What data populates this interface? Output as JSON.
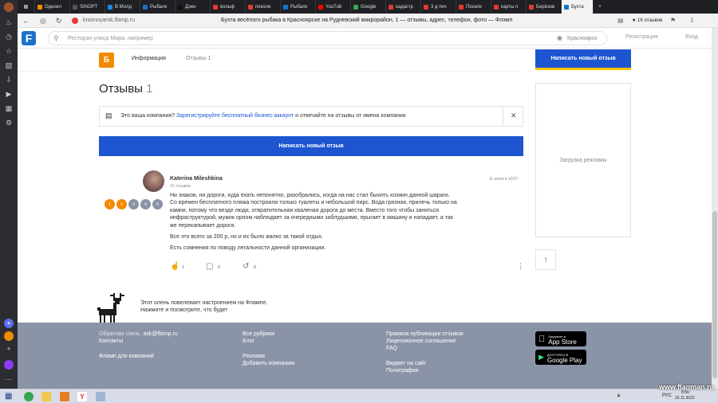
{
  "browser": {
    "tabs": [
      {
        "label": "Однокл",
        "color": "#f28a00"
      },
      {
        "label": "SINOPT",
        "color": "#555555"
      },
      {
        "label": "В Молд",
        "color": "#1e88e5"
      },
      {
        "label": "Рыбалк",
        "color": "#1a73c9"
      },
      {
        "label": "Дзен",
        "color": "#111111"
      },
      {
        "label": "вольф",
        "color": "#e53935"
      },
      {
        "label": "поколе",
        "color": "#e53935"
      },
      {
        "label": "Рыбалк",
        "color": "#1a73c9"
      },
      {
        "label": "YouTub",
        "color": "#ff0000"
      },
      {
        "label": "Google",
        "color": "#34a853"
      },
      {
        "label": "кадастр",
        "color": "#e53935"
      },
      {
        "label": "3 д печ",
        "color": "#e53935"
      },
      {
        "label": "Поселк",
        "color": "#e53935"
      },
      {
        "label": "карты п",
        "color": "#e53935"
      },
      {
        "label": "Берёзов",
        "color": "#e53935"
      },
      {
        "label": "Бухта",
        "color": "#1a73c9",
        "active": true
      }
    ],
    "url": "krasnoyarsk.flamp.ru",
    "page_title": "Бухта весёлого рыбака в Красноярске на Рудневский микрорайон, 1 — отзывы, адрес, телефон, фото — Флэмп",
    "reviews_badge": "1К отзывов"
  },
  "site": {
    "search_placeholder": "Ресторан улица Мира, например",
    "city": "Красноярск",
    "register": "Регистрация",
    "login": "Вход"
  },
  "company": {
    "logo_letter": "Б",
    "tab_info": "Информация",
    "tab_reviews": "Отзывы 1"
  },
  "reviews": {
    "heading": "Отзывы",
    "count": "1",
    "claim_prefix": "Это ваша компания?",
    "claim_link": "Зарегистрируйте бесплатный бизнес-аккаунт",
    "claim_suffix": "и отвечайте на отзывы от имени компании",
    "write_button": "Написать новый отзыв",
    "top_button": "Написать новый отзыв"
  },
  "review": {
    "author": "Katerina Mileshkina",
    "author_reviews": "12 отзывов",
    "date": "11 июля в 19:57",
    "rating_labels": [
      "1",
      "2",
      "3",
      "4",
      "5"
    ],
    "rating_value": 2,
    "rating_colors": [
      "#f28a00",
      "#f28a00",
      "#8a94a6",
      "#8a94a6",
      "#8a94a6"
    ],
    "paragraph1": "Ни знаков, ни дороги, куда ехать непонятно, разобрались, когда на нас стал быхить хозяин данной шараги. Со времен бесплатного пляжа построили только туалеты и небольшой пирс. Вода грязная, прилечь только на камни, потому что везде люди, отвратительная хваленая дорога до места. Вместо того чтобы заняться инфраструктурой, мужик орлом наблюдает за очередными заблудшими, прыгает в машину и нападает, а так же перекапывает дороги.",
    "paragraph2": "Все это всего за 200 р, но и их было жалко за такой отдых.",
    "paragraph3": "Есть сомнения по поводу легальности данной организации.",
    "likes": "1",
    "comments": "0",
    "shares": "0"
  },
  "ads": {
    "loading": "Загрузка рекламы"
  },
  "deer": {
    "line1": "Этот олень повелевает настроением на Флампе.",
    "line2": "Нажмите и посмотрите, что будет"
  },
  "footer": {
    "feedback_label": "Обратная связь:",
    "feedback_email": "ask@flamp.ru",
    "contacts": "Контакты",
    "business": "Фламп для компаний",
    "all_rubrics": "Все рубрики",
    "blog": "Блог",
    "ads": "Реклама",
    "add_company": "Добавить компанию",
    "rules": "Правила публикации отзывов",
    "license": "Лицензионное соглашение",
    "faq": "FAQ",
    "widget": "Виджет на сайт",
    "polygraphy": "Полиграфия",
    "appstore_small": "Загрузите в",
    "appstore_big": "App Store",
    "gplay_small": "ДОСТУПНО В",
    "gplay_big": "Google Play"
  },
  "taskbar": {
    "lang": "РУС",
    "time": "8:56",
    "date": "16.11.2022",
    "watermark": "www.flagman.ru"
  }
}
